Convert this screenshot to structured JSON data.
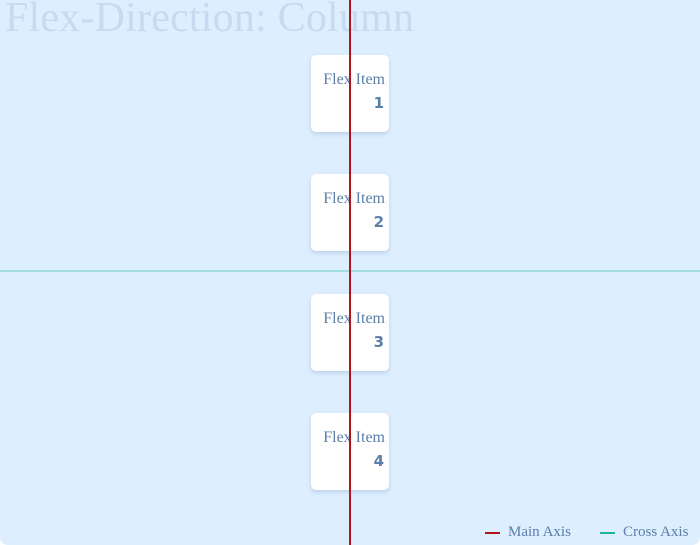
{
  "title": "Flex-Direction: Column",
  "items": [
    {
      "label": "Flex Item",
      "number": "1"
    },
    {
      "label": "Flex Item",
      "number": "2"
    },
    {
      "label": "Flex Item",
      "number": "3"
    },
    {
      "label": "Flex Item",
      "number": "4"
    }
  ],
  "legend": {
    "main_axis": {
      "label": "Main Axis",
      "color": "#b5141c"
    },
    "cross_axis": {
      "label": "Cross Axis",
      "color": "#1fb39a"
    }
  },
  "colors": {
    "background": "#ddeeff",
    "item_text": "#5a7fa8",
    "main_axis": "#b5141c",
    "cross_axis_line": "#a3dede"
  }
}
